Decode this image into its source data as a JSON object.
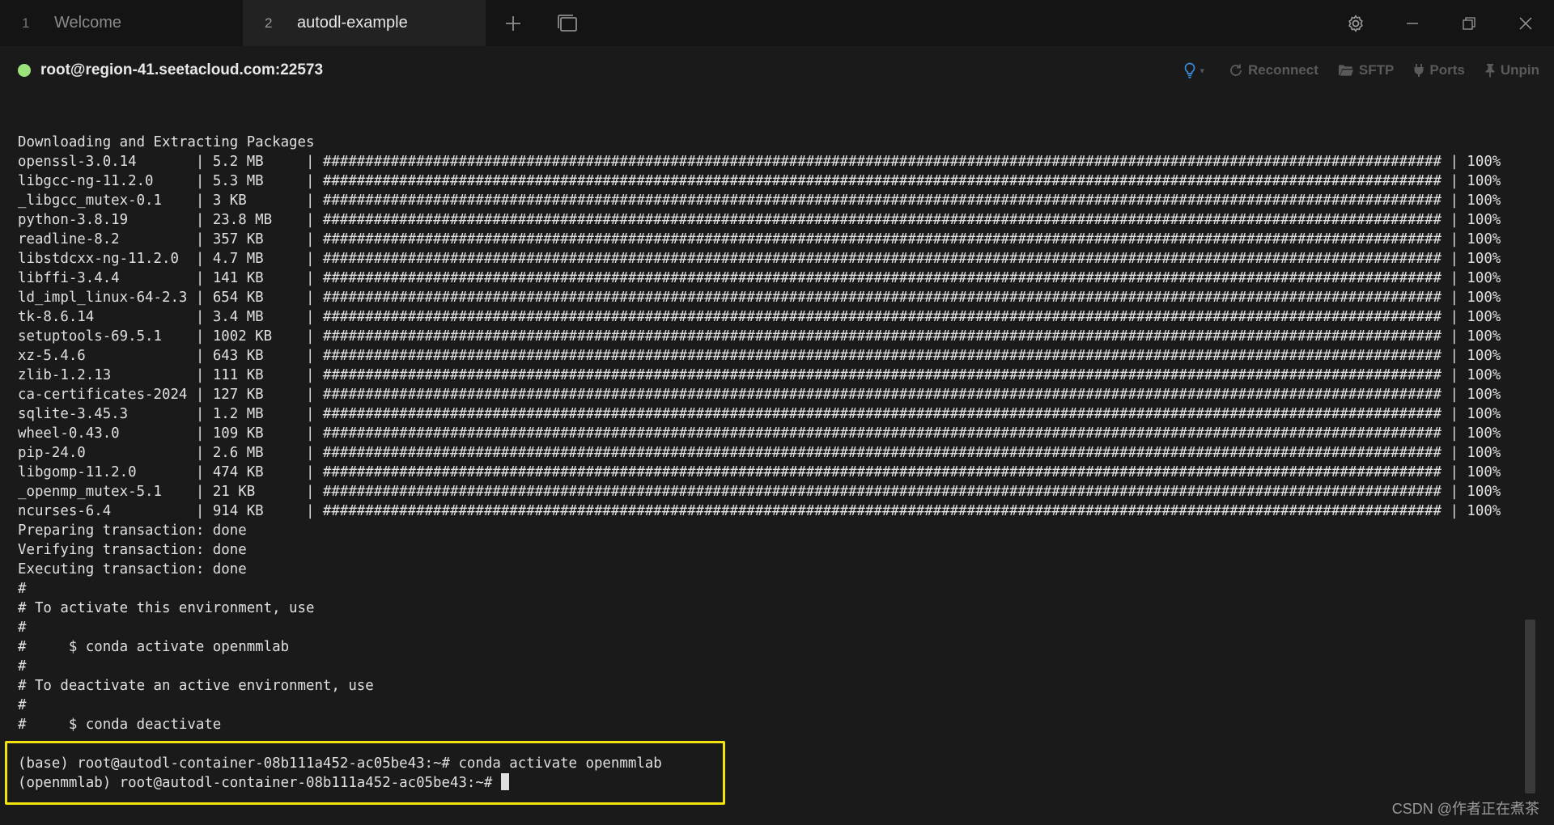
{
  "tabs": [
    {
      "num": "1",
      "label": "Welcome",
      "active": false
    },
    {
      "num": "2",
      "label": "autodl-example",
      "active": true
    }
  ],
  "icons": {
    "new_tab": "plus-icon",
    "tab_overview": "windows-icon",
    "settings": "gear-icon",
    "minimize": "minimize-icon",
    "restore": "restore-icon",
    "close": "close-icon"
  },
  "connection": {
    "host": "root@region-41.seetacloud.com:22573",
    "status_color": "#9be37a",
    "actions": {
      "reconnect": "Reconnect",
      "sftp": "SFTP",
      "ports": "Ports",
      "unpin": "Unpin"
    }
  },
  "terminal": {
    "header": "Downloading and Extracting Packages",
    "packages": [
      {
        "name": "openssl-3.0.14",
        "size": "5.2 MB",
        "percent": "100%"
      },
      {
        "name": "libgcc-ng-11.2.0",
        "size": "5.3 MB",
        "percent": "100%"
      },
      {
        "name": "_libgcc_mutex-0.1",
        "size": "3 KB",
        "percent": "100%"
      },
      {
        "name": "python-3.8.19",
        "size": "23.8 MB",
        "percent": "100%"
      },
      {
        "name": "readline-8.2",
        "size": "357 KB",
        "percent": "100%"
      },
      {
        "name": "libstdcxx-ng-11.2.0",
        "size": "4.7 MB",
        "percent": "100%"
      },
      {
        "name": "libffi-3.4.4",
        "size": "141 KB",
        "percent": "100%"
      },
      {
        "name": "ld_impl_linux-64-2.3",
        "size": "654 KB",
        "percent": "100%"
      },
      {
        "name": "tk-8.6.14",
        "size": "3.4 MB",
        "percent": "100%"
      },
      {
        "name": "setuptools-69.5.1",
        "size": "1002 KB",
        "percent": "100%"
      },
      {
        "name": "xz-5.4.6",
        "size": "643 KB",
        "percent": "100%"
      },
      {
        "name": "zlib-1.2.13",
        "size": "111 KB",
        "percent": "100%"
      },
      {
        "name": "ca-certificates-2024",
        "size": "127 KB",
        "percent": "100%"
      },
      {
        "name": "sqlite-3.45.3",
        "size": "1.2 MB",
        "percent": "100%"
      },
      {
        "name": "wheel-0.43.0",
        "size": "109 KB",
        "percent": "100%"
      },
      {
        "name": "pip-24.0",
        "size": "2.6 MB",
        "percent": "100%"
      },
      {
        "name": "libgomp-11.2.0",
        "size": "474 KB",
        "percent": "100%"
      },
      {
        "name": "_openmp_mutex-5.1",
        "size": "21 KB",
        "percent": "100%"
      },
      {
        "name": "ncurses-6.4",
        "size": "914 KB",
        "percent": "100%"
      }
    ],
    "progress_bar": "####################################################################################################################################",
    "after_lines": [
      "Preparing transaction: done",
      "Verifying transaction: done",
      "Executing transaction: done",
      "#",
      "# To activate this environment, use",
      "#",
      "#     $ conda activate openmmlab",
      "#",
      "# To deactivate an active environment, use",
      "#",
      "#     $ conda deactivate"
    ],
    "prompt_lines": [
      "(base) root@autodl-container-08b111a452-ac05be43:~# conda activate openmmlab",
      "(openmmlab) root@autodl-container-08b111a452-ac05be43:~# "
    ],
    "highlight_color": "#f2e30f"
  },
  "watermark": "CSDN @作者正在煮茶"
}
